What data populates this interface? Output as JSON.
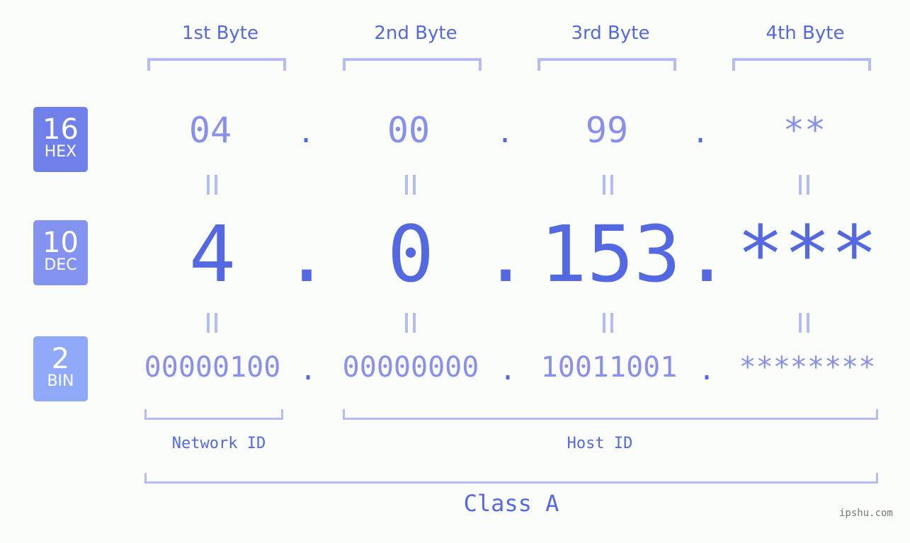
{
  "bytes": {
    "headers": [
      "1st Byte",
      "2nd Byte",
      "3rd Byte",
      "4th Byte"
    ],
    "hex": [
      "04",
      "00",
      "99",
      "**"
    ],
    "dec": [
      "4",
      "0",
      "153",
      "***"
    ],
    "bin": [
      "00000100",
      "00000000",
      "10011001",
      "********"
    ],
    "separator": "."
  },
  "badges": {
    "hex": {
      "num": "16",
      "label": "HEX",
      "color": "#7080ea"
    },
    "dec": {
      "num": "10",
      "label": "DEC",
      "color": "#8593f0"
    },
    "bin": {
      "num": "2",
      "label": "BIN",
      "color": "#90a8f8"
    }
  },
  "ids": {
    "network": "Network ID",
    "host": "Host ID"
  },
  "class_label": "Class A",
  "watermark": "ipshu.com",
  "colors": {
    "accent": "#5468e2",
    "light": "#8890ec",
    "bracket": "#b3bcf5"
  }
}
